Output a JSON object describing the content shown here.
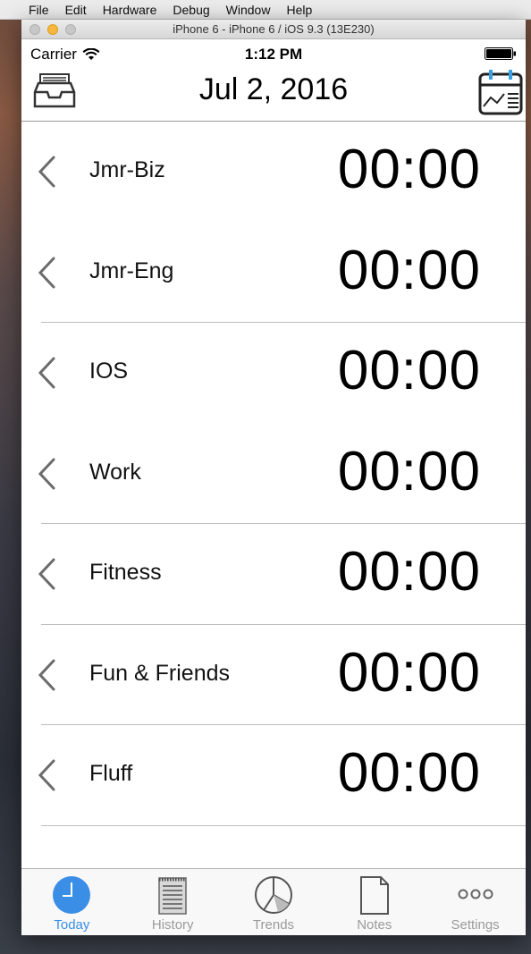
{
  "menubar": {
    "items": [
      "File",
      "Edit",
      "Hardware",
      "Debug",
      "Window",
      "Help"
    ]
  },
  "simulator": {
    "title": "iPhone 6 - iPhone 6 / iOS 9.3 (13E230)"
  },
  "status": {
    "carrier": "Carrier",
    "time": "1:12 PM"
  },
  "nav": {
    "title": "Jul 2, 2016",
    "left_icon": "inbox-tray-icon",
    "right_icon": "calendar-chart-icon"
  },
  "rows": [
    {
      "label": "Jmr-Biz",
      "time": "00:00"
    },
    {
      "label": "Jmr-Eng",
      "time": "00:00"
    },
    {
      "label": "IOS",
      "time": "00:00"
    },
    {
      "label": "Work",
      "time": "00:00"
    },
    {
      "label": "Fitness",
      "time": "00:00"
    },
    {
      "label": "Fun & Friends",
      "time": "00:00"
    },
    {
      "label": "Fluff",
      "time": "00:00"
    }
  ],
  "tabs": [
    {
      "label": "Today",
      "icon": "clock-icon",
      "active": true
    },
    {
      "label": "History",
      "icon": "notepad-icon",
      "active": false
    },
    {
      "label": "Trends",
      "icon": "pie-chart-icon",
      "active": false
    },
    {
      "label": "Notes",
      "icon": "document-icon",
      "active": false
    },
    {
      "label": "Settings",
      "icon": "more-icon",
      "active": false
    }
  ],
  "colors": {
    "accent": "#3a8ee6",
    "tab_inactive": "#9b9b9b",
    "separator": "#bdbdbd"
  }
}
